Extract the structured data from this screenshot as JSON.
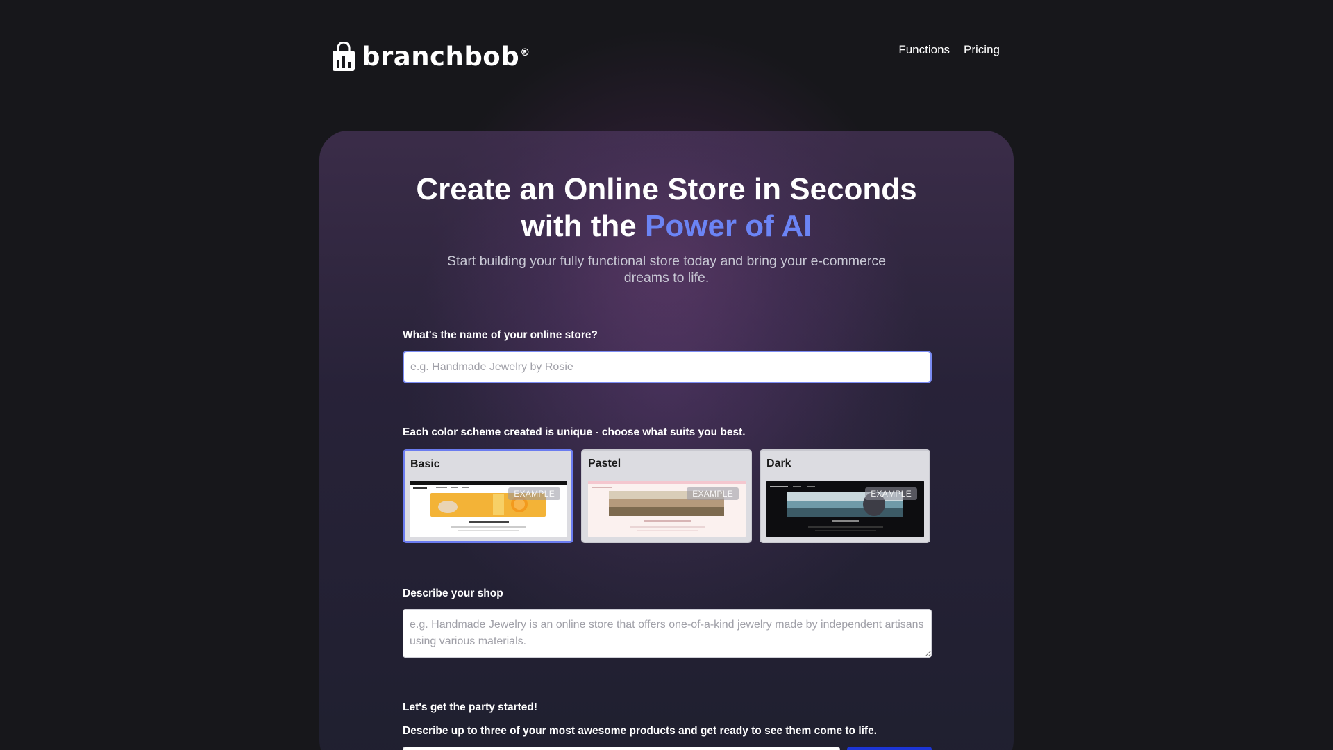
{
  "brand": {
    "name": "branchbob",
    "registered_mark": "®"
  },
  "nav": {
    "items": [
      {
        "label": "Functions"
      },
      {
        "label": "Pricing"
      }
    ]
  },
  "hero": {
    "title_line1": "Create an Online Store in Seconds",
    "title_line2_prefix": "with the ",
    "title_line2_accent": "Power of AI",
    "subtitle": "Start building your fully functional store today and bring your e-commerce dreams to life."
  },
  "form": {
    "store_name": {
      "label": "What's the name of your online store?",
      "placeholder": "e.g. Handmade Jewelry by Rosie",
      "value": ""
    },
    "color_scheme": {
      "label": "Each color scheme created is unique - choose what suits you best.",
      "selected": "Basic",
      "options": [
        {
          "name": "Basic",
          "badge": "EXAMPLE"
        },
        {
          "name": "Pastel",
          "badge": "EXAMPLE"
        },
        {
          "name": "Dark",
          "badge": "EXAMPLE"
        }
      ]
    },
    "description": {
      "label": "Describe your shop",
      "placeholder": "e.g. Handmade Jewelry is an online store that offers one-of-a-kind jewelry made by independent artisans using various materials.",
      "value": ""
    },
    "products": {
      "heading": "Let's get the party started!",
      "subheading": "Describe up to three of your most awesome products and get ready to see them come to life."
    }
  },
  "colors": {
    "background": "#17171b",
    "accent": "#6b84f5",
    "input_focus_border": "#7b8cf3",
    "primary_button": "#1c35d6"
  }
}
